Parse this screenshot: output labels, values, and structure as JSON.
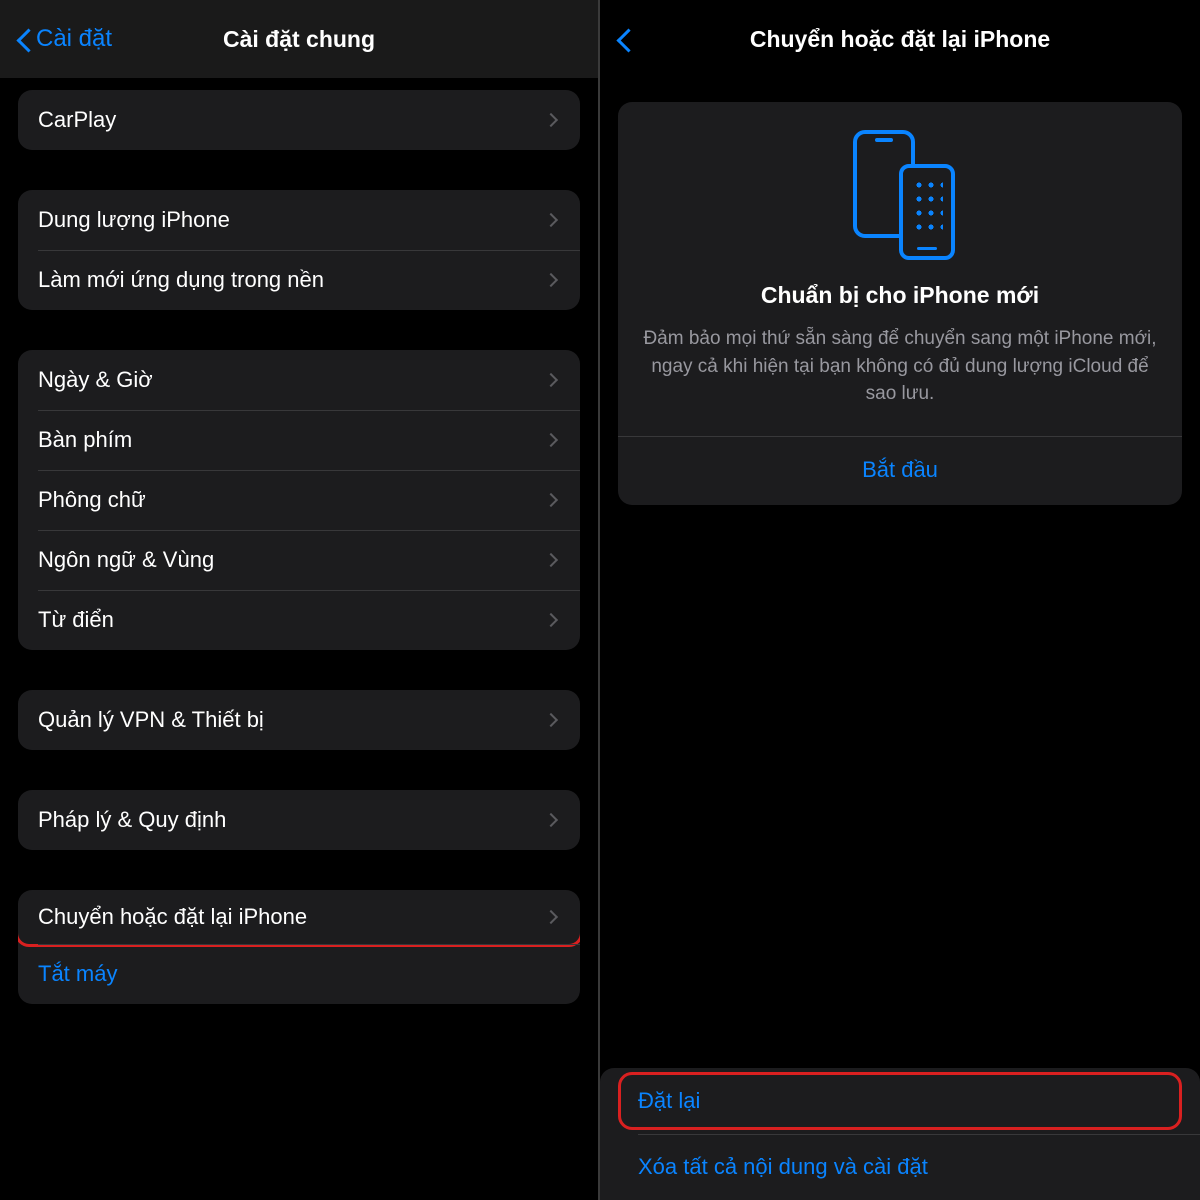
{
  "left": {
    "back_label": "Cài đặt",
    "title": "Cài đặt chung",
    "group1": [
      {
        "label": "CarPlay"
      }
    ],
    "group2": [
      {
        "label": "Dung lượng iPhone"
      },
      {
        "label": "Làm mới ứng dụng trong nền"
      }
    ],
    "group3": [
      {
        "label": "Ngày & Giờ"
      },
      {
        "label": "Bàn phím"
      },
      {
        "label": "Phông chữ"
      },
      {
        "label": "Ngôn ngữ & Vùng"
      },
      {
        "label": "Từ điển"
      }
    ],
    "group4": [
      {
        "label": "Quản lý VPN & Thiết bị"
      }
    ],
    "group5": [
      {
        "label": "Pháp lý & Quy định"
      }
    ],
    "group6": [
      {
        "label": "Chuyển hoặc đặt lại iPhone"
      },
      {
        "label": "Tắt máy",
        "blue": true,
        "no_chevron": true
      }
    ]
  },
  "right": {
    "title": "Chuyển hoặc đặt lại iPhone",
    "card": {
      "title": "Chuẩn bị cho iPhone mới",
      "desc": "Đảm bảo mọi thứ sẵn sàng để chuyển sang một iPhone mới, ngay cả khi hiện tại bạn không có đủ dung lượng iCloud để sao lưu.",
      "action": "Bắt đầu"
    },
    "bottom": [
      {
        "label": "Đặt lại"
      },
      {
        "label": "Xóa tất cả nội dung và cài đặt"
      }
    ]
  }
}
